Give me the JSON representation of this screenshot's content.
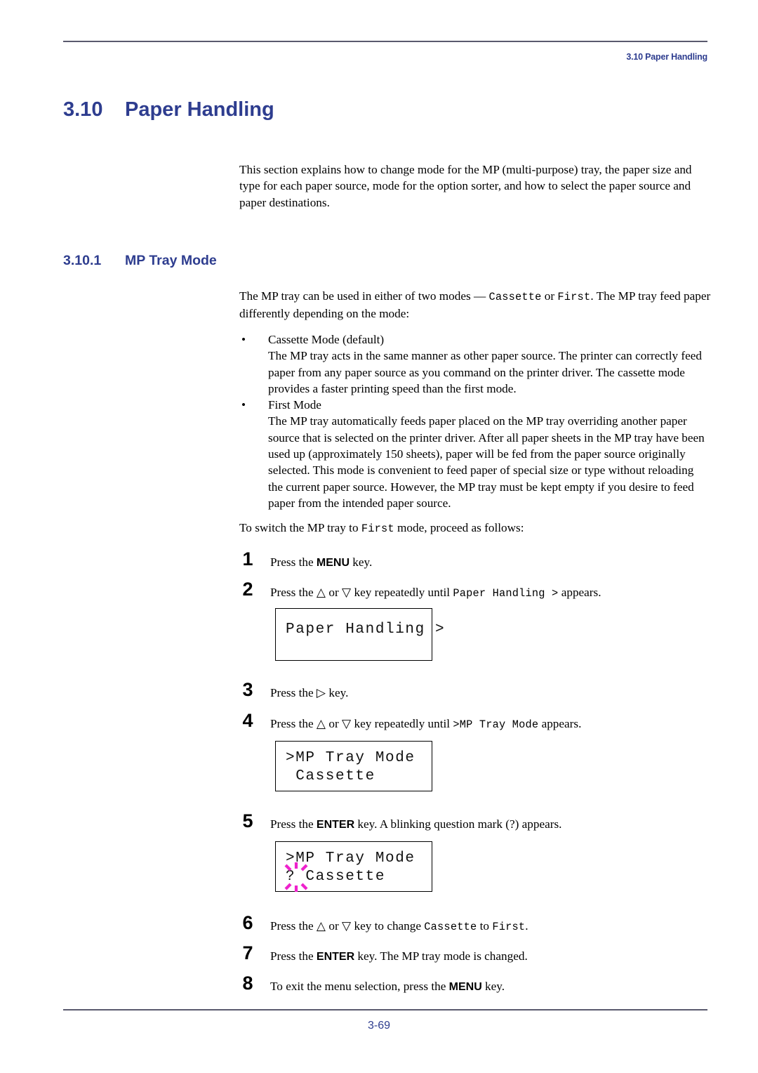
{
  "header": {
    "running_head": "3.10 Paper Handling"
  },
  "headings": {
    "section_number": "3.10",
    "section_title": "Paper Handling",
    "subsection_number": "3.10.1",
    "subsection_title": "MP Tray Mode"
  },
  "intro": {
    "paragraph": "This section explains how to change mode for the MP (multi-purpose) tray, the paper size and type for each paper source, mode for the option sorter, and how to select the paper source and paper destinations."
  },
  "mp_tray": {
    "lead_p1": "The MP tray can be used in either of two modes — ",
    "lead_mode_a": "Cassette",
    "lead_or": " or ",
    "lead_mode_b": "First",
    "lead_p2": ". The MP tray feed paper differently depending on the mode:",
    "bullet_marker": "•",
    "bullet1_label": "Cassette Mode (default)",
    "bullet1_body": "The MP tray acts in the same manner as other paper source. The printer can correctly feed paper from any paper source as you command on the printer driver. The cassette mode provides a faster printing speed than the first mode.",
    "bullet2_label": "First Mode",
    "bullet2_body": "The MP tray automatically feeds paper placed on the MP tray overriding another paper source that is selected on the printer driver. After all paper sheets in the MP tray have been used up (approximately 150 sheets), paper will be fed from the paper source originally selected. This mode is convenient to feed paper of special size or type without reloading the current paper source. However, the MP tray must be kept empty if you desire to feed paper from the intended paper source.",
    "switch_intro_a": "To switch the MP tray to ",
    "switch_intro_mode": "First",
    "switch_intro_b": " mode, proceed as follows:"
  },
  "steps": [
    {
      "number": "1",
      "pre": "Press the ",
      "key": "MENU",
      "post": " key."
    },
    {
      "number": "2",
      "pre": "Press the ",
      "key_up": "△",
      "mid": " or ",
      "key_down": "▽",
      "post_a": " key repeatedly until ",
      "mono": "Paper Handling >",
      "post_b": " appears."
    },
    {
      "number": "3",
      "pre": "Press the ",
      "key_right": "▷",
      "post": " key."
    },
    {
      "number": "4",
      "pre": "Press the ",
      "key_up": "△",
      "mid": " or ",
      "key_down": "▽",
      "post_a": " key repeatedly until ",
      "mono": ">MP Tray Mode",
      "post_b": " appears."
    },
    {
      "number": "5",
      "pre": "Press the ",
      "key": "ENTER",
      "post": " key. A blinking question mark (?) appears."
    },
    {
      "number": "6",
      "pre": "Press the ",
      "key_up": "△",
      "mid": " or ",
      "key_down": "▽",
      "post_a": " key to change ",
      "mono_a": "Cassette",
      "post_b": " to ",
      "mono_b": "First",
      "post_c": "."
    },
    {
      "number": "7",
      "pre": "Press the ",
      "key": "ENTER",
      "post": " key. The MP tray mode is changed."
    },
    {
      "number": "8",
      "pre": "To exit the menu selection, press the ",
      "key": "MENU",
      "post": " key."
    }
  ],
  "lcd_panels": [
    {
      "id": "lcd-paper-handling",
      "line1": "Paper Handling >",
      "line2": ""
    },
    {
      "id": "lcd-mp-tray-cassette",
      "line1": ">MP Tray Mode",
      "line2": " Cassette"
    },
    {
      "id": "lcd-mp-tray-question",
      "line1": ">MP Tray Mode",
      "line2": "? Cassette",
      "blink_indicator": "blink-starburst"
    }
  ],
  "footer": {
    "page_number": "3-69"
  },
  "colors": {
    "heading_blue": "#2e3d8f",
    "rule_gray": "#5a5a6e",
    "blink_magenta": "#ee22cc"
  }
}
